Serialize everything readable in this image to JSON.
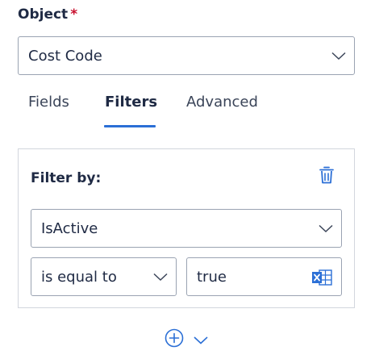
{
  "object": {
    "label": "Object",
    "required_mark": "*",
    "value": "Cost Code"
  },
  "tabs": [
    {
      "label": "Fields",
      "active": false
    },
    {
      "label": "Filters",
      "active": true
    },
    {
      "label": "Advanced",
      "active": false
    }
  ],
  "filter": {
    "heading": "Filter by:",
    "field": "IsActive",
    "operator": "is equal to",
    "value": "true"
  },
  "icons": {
    "delete": "trash-icon",
    "excel": "excel-icon",
    "add": "plus-circle-icon",
    "expand": "chevron-down-icon"
  },
  "colors": {
    "accent": "#2b6fd6",
    "required": "#c8102e",
    "text": "#1f2a44"
  }
}
